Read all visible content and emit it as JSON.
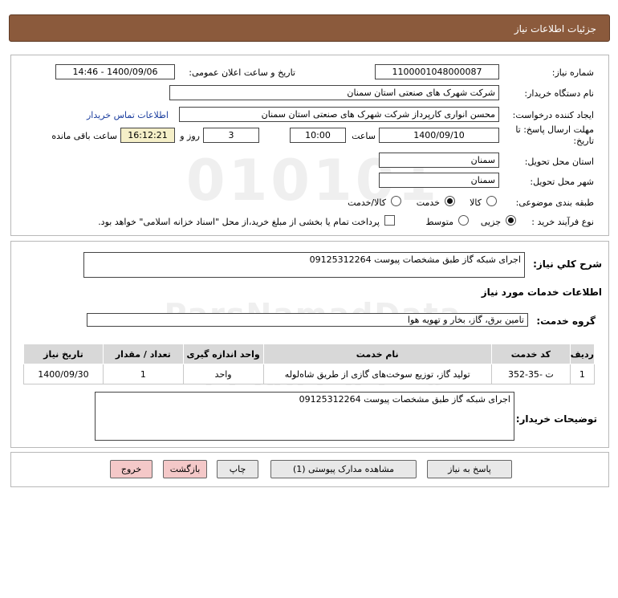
{
  "header": {
    "title": "جزئیات اطلاعات نیاز"
  },
  "fields": {
    "need_number_label": "شماره نیاز:",
    "need_number": "1100001048000087",
    "announce_label": "تاریخ و ساعت اعلان عمومی:",
    "announce_value": "1400/09/06 - 14:46",
    "buyer_org_label": "نام دستگاه خریدار:",
    "buyer_org": "شرکت شهرک های صنعتی استان سمنان",
    "requester_label": "ایجاد کننده درخواست:",
    "requester": "محسن انواری کارپرداز شرکت شهرک های صنعتی استان سمنان",
    "contact_link": "اطلاعات تماس خریدار",
    "deadline_label": "مهلت ارسال پاسخ: تا تاریخ:",
    "deadline_date": "1400/09/10",
    "time_label": "ساعت",
    "deadline_time": "10:00",
    "days_value": "3",
    "days_label": "روز و",
    "remaining_time": "16:12:21",
    "remaining_label": "ساعت باقی مانده",
    "province_label": "استان محل تحویل:",
    "province": "سمنان",
    "city_label": "شهر محل تحویل:",
    "city": "سمنان",
    "category_label": "طبقه بندی موضوعی:",
    "category_options": [
      "کالا",
      "خدمت",
      "کالا/خدمت"
    ],
    "process_label": "نوع فرآیند خرید :",
    "process_options": [
      "جزیی",
      "متوسط"
    ],
    "payment_note": "پرداخت تمام یا بخشی از مبلغ خرید،از محل \"اسناد خزانه اسلامی\" خواهد بود."
  },
  "description": {
    "label": "شرح کلي نياز:",
    "value": "اجرای شبکه گاز طبق مشخصات پیوست 09125312264"
  },
  "services": {
    "section_title": "اطلاعات خدمات مورد نیاز",
    "group_label": "گروه خدمت:",
    "group_value": "تامین برق، گاز، بخار و تهویه هوا",
    "columns": [
      "ردیف",
      "کد خدمت",
      "نام خدمت",
      "واحد اندازه گیری",
      "تعداد / مقدار",
      "تاریخ نیاز"
    ],
    "rows": [
      [
        "1",
        "ت -35-352",
        "تولید گاز، توزیع سوخت‌های گازی از طریق شاه‌لوله",
        "واحد",
        "1",
        "1400/09/30"
      ]
    ]
  },
  "buyer_notes": {
    "label": "توضیحات خریدار:",
    "value": "اجرای شبکه گاز طبق مشخصات پیوست 09125312264"
  },
  "buttons": {
    "reply": "پاسخ به نیاز",
    "attachments": "مشاهده مدارک پیوستی (1)",
    "print": "چاپ",
    "back": "بازگشت",
    "exit": "خروج"
  },
  "colors": {
    "header_bg": "#8b5a3c",
    "highlight": "#f5efc8",
    "link": "#1a3d9e"
  }
}
